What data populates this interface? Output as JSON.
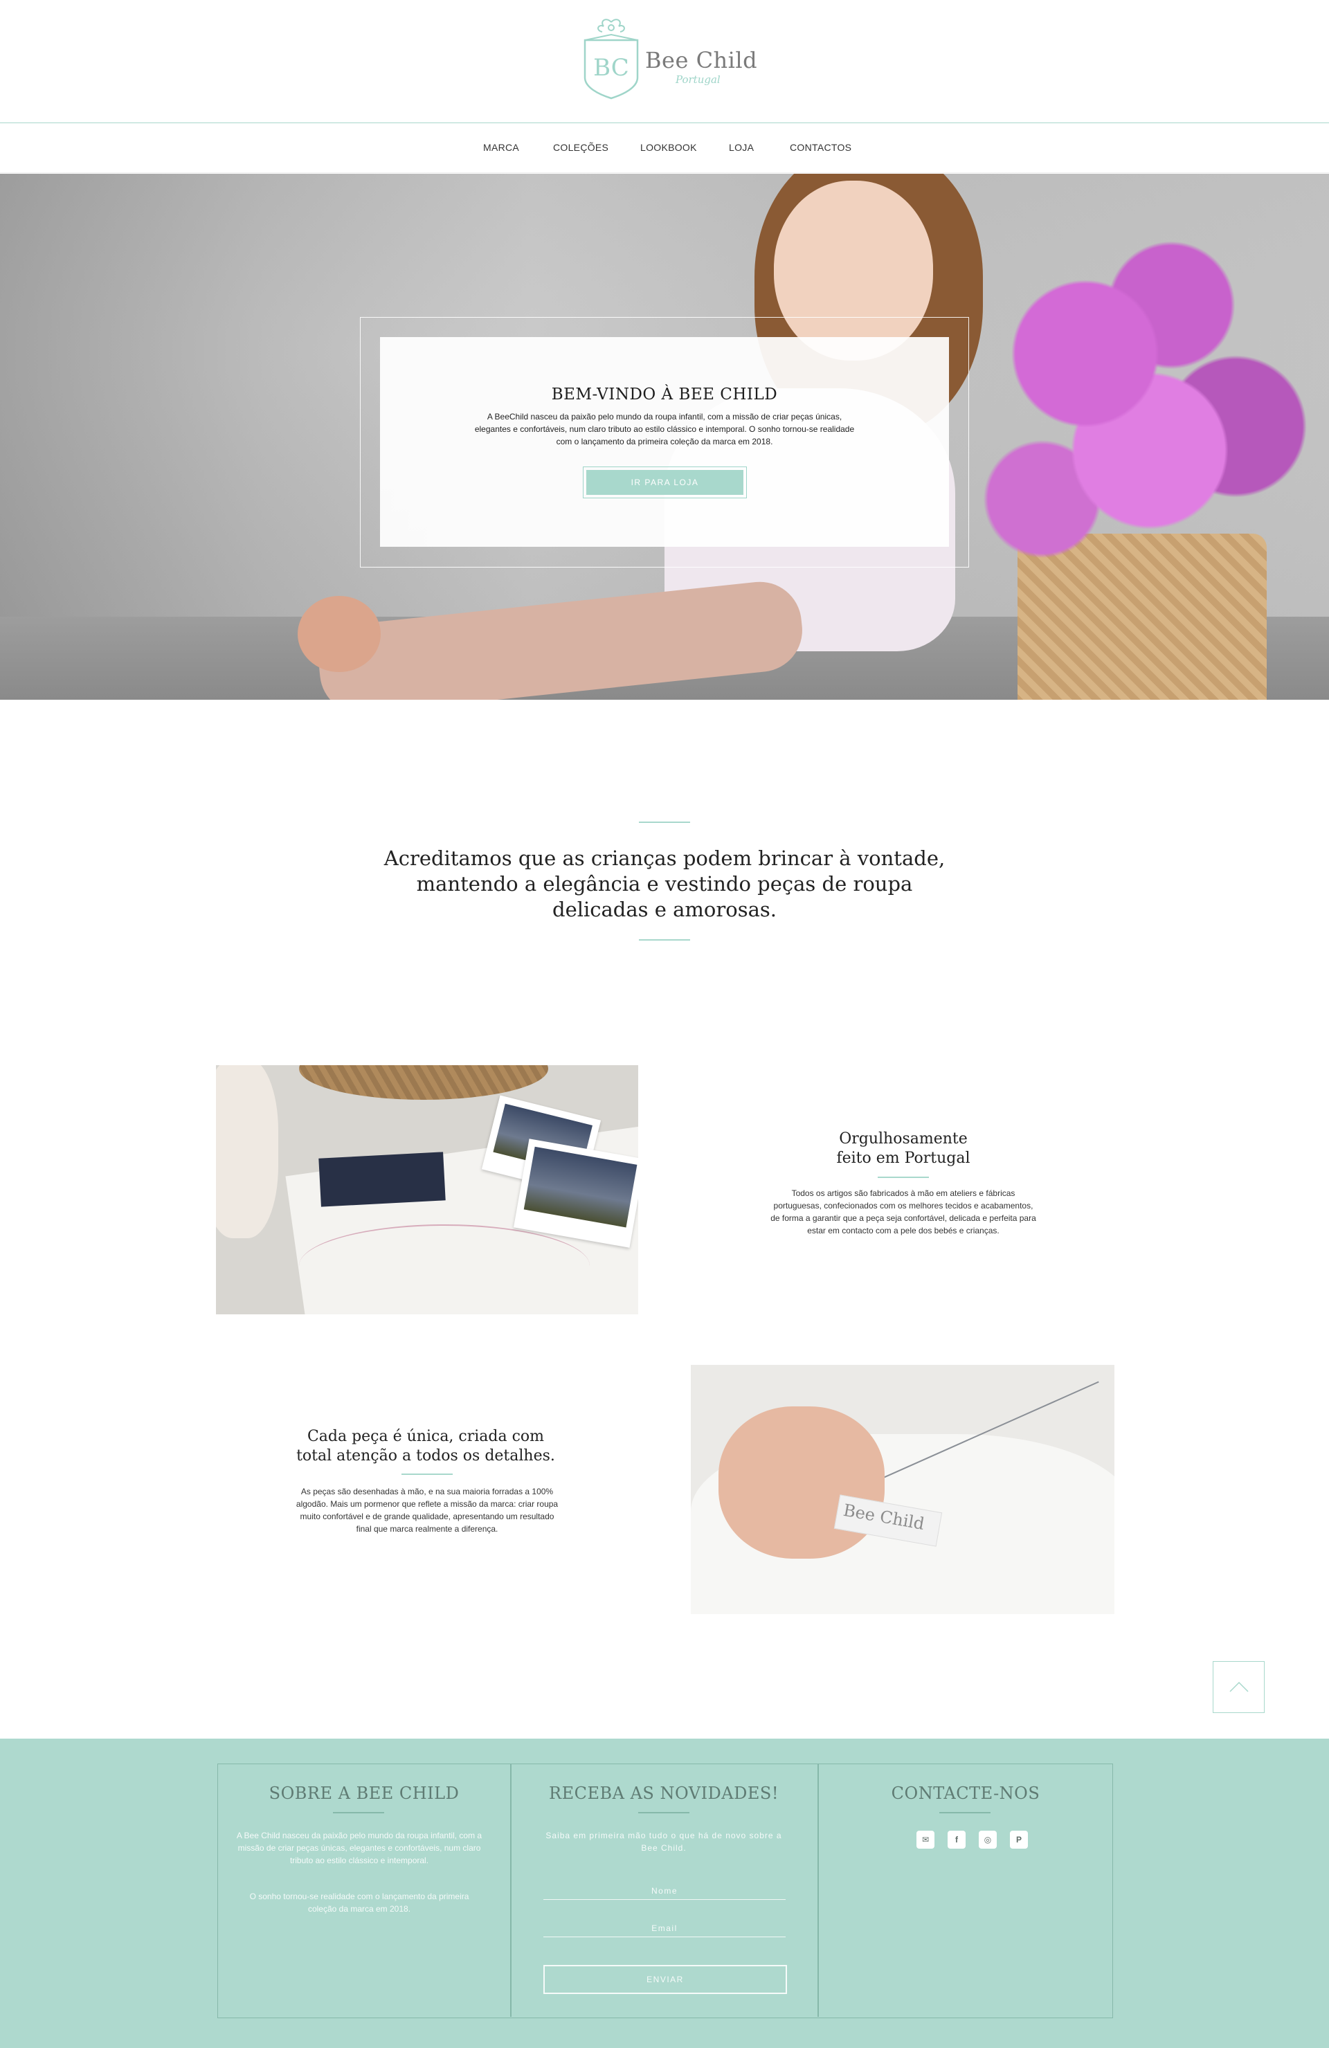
{
  "brand": {
    "monogram": "BC",
    "name": "Bee Child",
    "subtitle": "Portugal",
    "accent_color": "#a8d8cc"
  },
  "nav": {
    "items": [
      {
        "label": "MARCA"
      },
      {
        "label": "COLEÇÕES"
      },
      {
        "label": "LOOKBOOK"
      },
      {
        "label": "LOJA"
      },
      {
        "label": "CONTACTOS"
      }
    ]
  },
  "hero": {
    "title": "BEM-VINDO À BEE CHILD",
    "text": "A BeeChild nasceu da paixão pelo mundo da roupa infantil, com a missão de criar peças únicas, elegantes e confortáveis, num claro tributo ao estilo clássico e intemporal. O sonho tornou-se realidade com o lançamento da primeira coleção da marca em 2018.",
    "button_label": "IR PARA LOJA"
  },
  "mission": {
    "text": "Acreditamos que as crianças podem brincar à vontade, mantendo a elegância e vestindo peças de roupa delicadas e amorosas."
  },
  "features": [
    {
      "title_line1": "Orgulhosamente",
      "title_line2": "feito em Portugal",
      "text": "Todos os artigos são fabricados à mão em ateliers e fábricas portuguesas, confecionados com os melhores tecidos e acabamentos, de forma a garantir que a peça seja confortável, delicada e perfeita para estar em contacto com a pele dos bebés e crianças."
    },
    {
      "title_line1": "Cada peça é única, criada com",
      "title_line2": "total atenção a todos os detalhes.",
      "text": "As peças são desenhadas à mão, e na sua maioria forradas a 100% algodão. Mais um pormenor que reflete a missão da marca: criar roupa muito confortável e de grande qualidade, apresentando um resultado final que marca realmente a diferença.",
      "photo_label": "Bee Child"
    }
  ],
  "footer": {
    "about": {
      "title": "SOBRE A BEE CHILD",
      "text1": "A Bee Child nasceu da paixão pelo mundo da roupa infantil, com a missão de criar peças únicas, elegantes e confortáveis, num claro tributo ao estilo clássico e intemporal.",
      "text2": "O sonho tornou-se realidade com o lançamento da primeira coleção da marca em 2018."
    },
    "newsletter": {
      "title": "RECEBA AS NOVIDADES!",
      "text": "Saiba em primeira mão tudo o que há de novo sobre a Bee Child.",
      "name_placeholder": "Nome",
      "email_placeholder": "Email",
      "button_label": "ENVIAR"
    },
    "contact": {
      "title": "CONTACTE-NOS",
      "socials": [
        "mail-icon",
        "facebook-icon",
        "instagram-icon",
        "pinterest-icon"
      ]
    }
  }
}
